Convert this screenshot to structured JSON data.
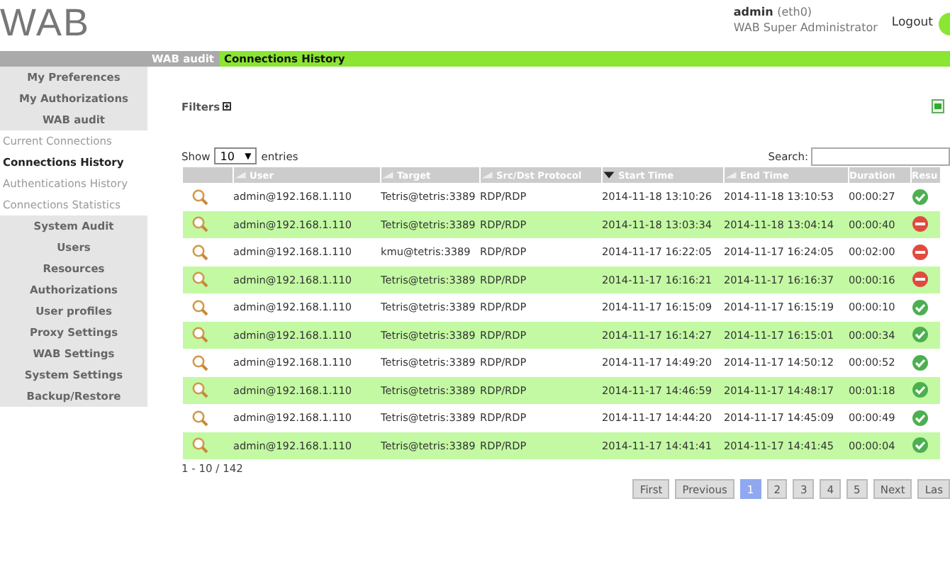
{
  "header": {
    "logo": "WAB",
    "user": "admin",
    "interface": "(eth0)",
    "role": "WAB Super Administrator",
    "logout": "Logout"
  },
  "breadcrumb": [
    "WAB audit",
    "Connections History"
  ],
  "sidebar": {
    "items": [
      {
        "label": "My Preferences",
        "kind": "section",
        "selected": false
      },
      {
        "label": "My Authorizations",
        "kind": "section",
        "selected": false
      },
      {
        "label": "WAB audit",
        "kind": "section",
        "selected": false
      },
      {
        "label": "Current Connections",
        "kind": "subitem",
        "selected": false
      },
      {
        "label": "Connections History",
        "kind": "subitem",
        "selected": true
      },
      {
        "label": "Authentications History",
        "kind": "subitem",
        "selected": false
      },
      {
        "label": "Connections Statistics",
        "kind": "subitem",
        "selected": false
      },
      {
        "label": "System Audit",
        "kind": "section",
        "selected": false
      },
      {
        "label": "Users",
        "kind": "section",
        "selected": false
      },
      {
        "label": "Resources",
        "kind": "section",
        "selected": false
      },
      {
        "label": "Authorizations",
        "kind": "section",
        "selected": false
      },
      {
        "label": "User profiles",
        "kind": "section",
        "selected": false
      },
      {
        "label": "Proxy Settings",
        "kind": "section",
        "selected": false
      },
      {
        "label": "WAB Settings",
        "kind": "section",
        "selected": false
      },
      {
        "label": "System Settings",
        "kind": "section",
        "selected": false
      },
      {
        "label": "Backup/Restore",
        "kind": "section",
        "selected": false
      }
    ]
  },
  "filters": {
    "label": "Filters"
  },
  "length": {
    "prefix": "Show",
    "value": "10",
    "caret": "▼",
    "suffix": "entries"
  },
  "search": {
    "label": "Search:"
  },
  "table": {
    "columns": [
      {
        "label": "User",
        "sortable": true,
        "sorted": false
      },
      {
        "label": "Target",
        "sortable": true,
        "sorted": false
      },
      {
        "label": "Src/Dst Protocol",
        "sortable": true,
        "sorted": false
      },
      {
        "label": "Start Time",
        "sortable": true,
        "sorted": true
      },
      {
        "label": "End Time",
        "sortable": true,
        "sorted": false
      },
      {
        "label": "Duration",
        "sortable": false
      },
      {
        "label": "Resu",
        "sortable": false
      }
    ],
    "rows": [
      {
        "user": "admin@192.168.1.110",
        "target": "Tetris@tetris:3389",
        "protocol": "RDP/RDP",
        "start": "2014-11-18 13:10:26",
        "end": "2014-11-18 13:10:53",
        "duration": "00:00:27",
        "success": true
      },
      {
        "user": "admin@192.168.1.110",
        "target": "Tetris@tetris:3389",
        "protocol": "RDP/RDP",
        "start": "2014-11-18 13:03:34",
        "end": "2014-11-18 13:04:14",
        "duration": "00:00:40",
        "success": false
      },
      {
        "user": "admin@192.168.1.110",
        "target": "kmu@tetris:3389",
        "protocol": "RDP/RDP",
        "start": "2014-11-17 16:22:05",
        "end": "2014-11-17 16:24:05",
        "duration": "00:02:00",
        "success": false
      },
      {
        "user": "admin@192.168.1.110",
        "target": "Tetris@tetris:3389",
        "protocol": "RDP/RDP",
        "start": "2014-11-17 16:16:21",
        "end": "2014-11-17 16:16:37",
        "duration": "00:00:16",
        "success": false
      },
      {
        "user": "admin@192.168.1.110",
        "target": "Tetris@tetris:3389",
        "protocol": "RDP/RDP",
        "start": "2014-11-17 16:15:09",
        "end": "2014-11-17 16:15:19",
        "duration": "00:00:10",
        "success": true
      },
      {
        "user": "admin@192.168.1.110",
        "target": "Tetris@tetris:3389",
        "protocol": "RDP/RDP",
        "start": "2014-11-17 16:14:27",
        "end": "2014-11-17 16:15:01",
        "duration": "00:00:34",
        "success": true
      },
      {
        "user": "admin@192.168.1.110",
        "target": "Tetris@tetris:3389",
        "protocol": "RDP/RDP",
        "start": "2014-11-17 14:49:20",
        "end": "2014-11-17 14:50:12",
        "duration": "00:00:52",
        "success": true
      },
      {
        "user": "admin@192.168.1.110",
        "target": "Tetris@tetris:3389",
        "protocol": "RDP/RDP",
        "start": "2014-11-17 14:46:59",
        "end": "2014-11-17 14:48:17",
        "duration": "00:01:18",
        "success": true
      },
      {
        "user": "admin@192.168.1.110",
        "target": "Tetris@tetris:3389",
        "protocol": "RDP/RDP",
        "start": "2014-11-17 14:44:20",
        "end": "2014-11-17 14:45:09",
        "duration": "00:00:49",
        "success": true
      },
      {
        "user": "admin@192.168.1.110",
        "target": "Tetris@tetris:3389",
        "protocol": "RDP/RDP",
        "start": "2014-11-17 14:41:41",
        "end": "2014-11-17 14:41:45",
        "duration": "00:00:04",
        "success": true
      }
    ]
  },
  "info": "1 - 10 / 142",
  "pagination": [
    {
      "label": "First",
      "selected": false
    },
    {
      "label": "Previous",
      "selected": false
    },
    {
      "label": "1",
      "selected": true
    },
    {
      "label": "2",
      "selected": false
    },
    {
      "label": "3",
      "selected": false
    },
    {
      "label": "4",
      "selected": false
    },
    {
      "label": "5",
      "selected": false
    },
    {
      "label": "Next",
      "selected": false
    },
    {
      "label": "Las",
      "selected": false
    }
  ]
}
